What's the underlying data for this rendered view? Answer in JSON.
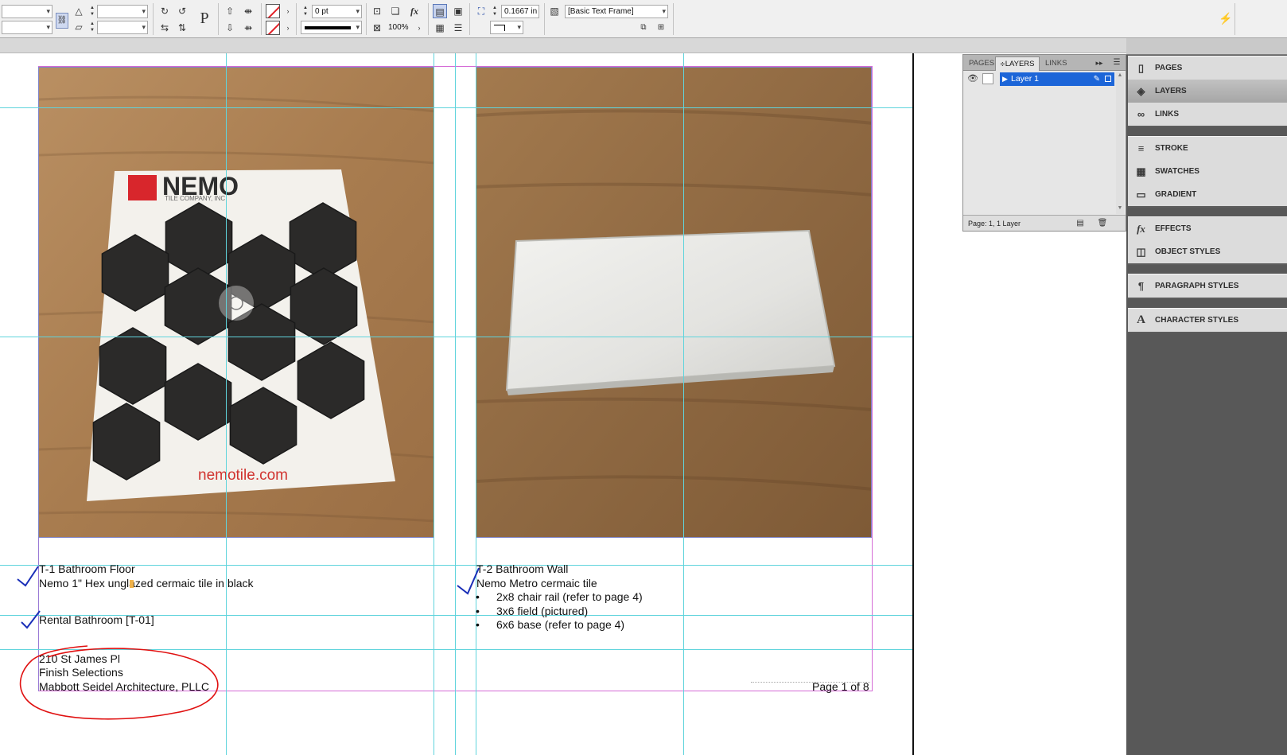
{
  "control_bar": {
    "stroke_weight": "0 pt",
    "opacity": "100%",
    "offset": "0.1667 in",
    "object_style": "[Basic Text Frame]"
  },
  "layers_panel": {
    "tabs": [
      "PAGES",
      "LAYERS",
      "LINKS"
    ],
    "active_tab": "LAYERS",
    "layer_name": "Layer 1",
    "footer": "Page: 1, 1 Layer"
  },
  "dock": {
    "groups": [
      [
        "PAGES",
        "LAYERS",
        "LINKS"
      ],
      [
        "STROKE",
        "SWATCHES",
        "GRADIENT"
      ],
      [
        "EFFECTS",
        "OBJECT STYLES"
      ],
      [
        "PARAGRAPH STYLES"
      ],
      [
        "CHARACTER STYLES"
      ]
    ],
    "active_item": "LAYERS",
    "icons": {
      "PAGES": "pages-icon",
      "LAYERS": "layers-icon",
      "LINKS": "links-icon",
      "STROKE": "stroke-icon",
      "SWATCHES": "swatches-icon",
      "GRADIENT": "gradient-icon",
      "EFFECTS": "effects-icon",
      "OBJECT STYLES": "object-styles-icon",
      "PARAGRAPH STYLES": "paragraph-styles-icon",
      "CHARACTER STYLES": "character-styles-icon"
    }
  },
  "document": {
    "photo_left": {
      "brand_logo": "NEMO",
      "brand_tagline": "TILE COMPANY, INC",
      "url_text": "nemotile.com"
    },
    "caption_left": {
      "line1": "T-1 Bathroom Floor",
      "line2": "Nemo 1\" Hex unglazed cermaic tile in black",
      "line3": "Rental Bathroom [T-01]"
    },
    "caption_right": {
      "line1": "T-2 Bathroom Wall",
      "line2": "Nemo Metro cermaic tile",
      "bullets": [
        "2x8 chair rail (refer to page 4)",
        "3x6 field (pictured)",
        "6x6 base (refer to page 4)"
      ]
    },
    "project_block": {
      "line1": "210 St James Pl",
      "line2": "Finish Selections",
      "line3": "Mabbott Seidel Architecture, PLLC"
    },
    "page_number": "Page 1 of 8"
  },
  "colors": {
    "guide": "#5fd4dc",
    "margin": "#d46ad6",
    "markup": "#e01111",
    "checkmark": "#1a2fb8",
    "selection": "#1c65d8"
  }
}
